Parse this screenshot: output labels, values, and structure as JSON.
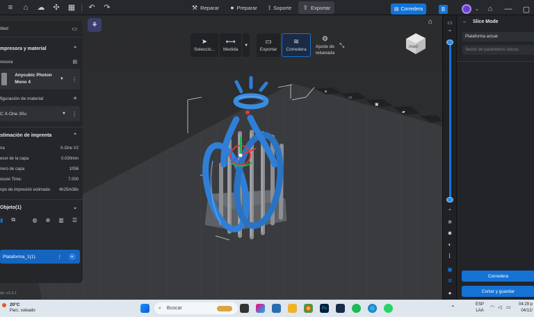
{
  "topbar": {
    "steps": [
      {
        "label": "Reparar",
        "icon": "repair-icon",
        "glyph": "⚒"
      },
      {
        "label": "Preparar",
        "icon": "prepare-icon",
        "glyph": "●"
      },
      {
        "label": "Soporte",
        "icon": "support-icon",
        "glyph": "⟟"
      },
      {
        "label": "Exportar",
        "icon": "export-icon",
        "glyph": "⇪"
      }
    ],
    "active_step": "Exportar",
    "slicer_button": "Corredera",
    "accent": "#1573d6"
  },
  "view_toolbar": {
    "items": [
      "Selecció...",
      "Medida",
      "Exportar",
      "Corredera"
    ],
    "slice_settings": [
      "Ajuste de",
      "rebanada"
    ]
  },
  "left_panel": {
    "project_name": "itled",
    "printer_section": {
      "title": "mpresora y material",
      "printer_label": "resora",
      "printer_name": [
        "Anycubic Photon",
        "Mono 4"
      ],
      "material_label": "figuración de material",
      "material_name": "C X-One 30u"
    },
    "print_estimate": {
      "title": "stimación de imprenta",
      "rows": [
        {
          "k": "na",
          "v": "X-One V2"
        },
        {
          "k": "esor de la capa",
          "v": "0.030mm"
        },
        {
          "k": "nero de capa",
          "v": "1056"
        },
        {
          "k": "osure Time:",
          "v": "7.000"
        },
        {
          "k": "npo de impresión estimado",
          "v": "4h25m38s"
        }
      ]
    },
    "objects": {
      "title": "Objeto(1)",
      "item": "Plataforma_1(1)"
    },
    "version": "ón: v1.0.1"
  },
  "right_panel": {
    "title": "Slice Mode",
    "platform_field": "Plataforma actual",
    "search_placeholder": "Sector de parámetros únicos",
    "slice_button": "Corredera",
    "cut_save_button": "Cortar y guardar"
  },
  "taskbar": {
    "weather_temp": "20°C",
    "weather_desc": "Parc. soleado",
    "search_placeholder": "Buscar",
    "lang_top": "ESP",
    "lang_bottom": "LAA",
    "time": "04:29 p",
    "date": "04/12/"
  },
  "colors": {
    "model_blue": "#2f7fd6",
    "support_gray": "#8d8f93",
    "plate": "#3a3b3e"
  }
}
